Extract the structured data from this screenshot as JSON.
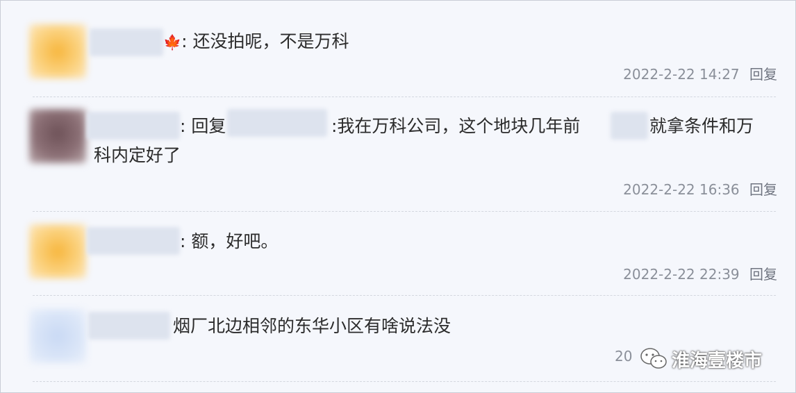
{
  "comments": [
    {
      "text": ": 还没拍呢，不是万科",
      "timestamp": "2022-2-22 14:27",
      "reply_label": "回复",
      "avatar_color": "#f7b63d",
      "name_suffix_icon": "maple-leaf-icon"
    },
    {
      "reply_prefix": ": 回复",
      "text_line1": ":我在万科公司，这个地块几年前",
      "text_line1_end": "就拿条件和万",
      "text_line2": "科内定好了",
      "timestamp": "2022-2-22 16:36",
      "reply_label": "回复",
      "avatar_color": "#6e5258"
    },
    {
      "text": ": 额，好吧。",
      "timestamp": "2022-2-22 22:39",
      "reply_label": "回复",
      "avatar_color": "#f7b63d"
    },
    {
      "text": "烟厂北边相邻的东华小区有啥说法没",
      "timestamp_partial": "20",
      "avatar_color": "#c9d9f4"
    }
  ],
  "watermark": {
    "text": "淮海壹楼市",
    "icon": "wechat-icon"
  }
}
